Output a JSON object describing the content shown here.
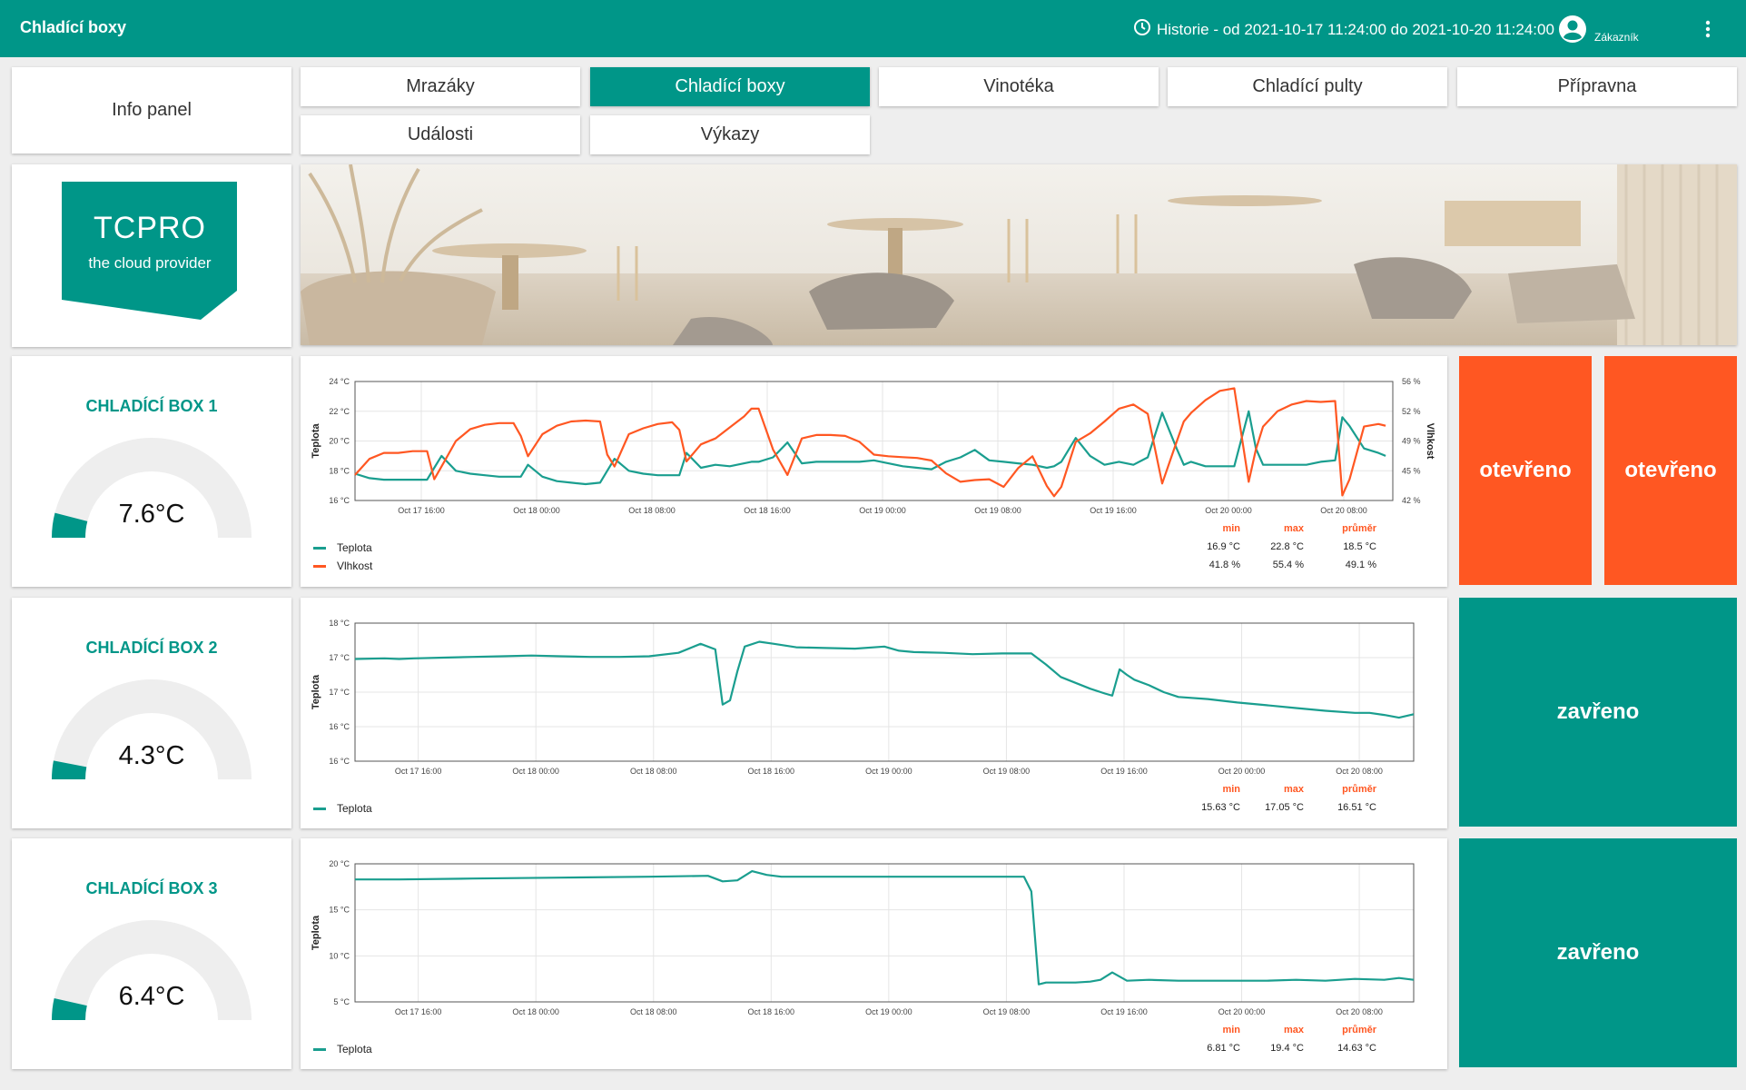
{
  "header": {
    "title": "Chladící boxy",
    "history": "Historie - od 2021-10-17 11:24:00 do 2021-10-20 11:24:00",
    "user_role": "Zákazník",
    "history_icon": "clock-icon",
    "user_icon": "account-circle-icon",
    "menu_icon": "more-vert-icon"
  },
  "colors": {
    "primary": "#009688",
    "accent": "#ff5722",
    "teplota": "#1a9e8f",
    "vlhkost": "#ff5722"
  },
  "nav": {
    "info_panel": "Info panel",
    "tabs": [
      "Mrazáky",
      "Chladící boxy",
      "Vinotéka",
      "Chladící pulty",
      "Přípravna",
      "Události",
      "Výkazy"
    ],
    "active": "Chladící boxy"
  },
  "logo": {
    "name": "TCPRO",
    "tagline": "the cloud provider"
  },
  "boxes": [
    {
      "title": "CHLADÍCÍ BOX 1",
      "value": "7.6°C",
      "fraction": 0.08,
      "status": [
        "otevřeno",
        "otevřeno"
      ]
    },
    {
      "title": "CHLADÍCÍ BOX 2",
      "value": "4.3°C",
      "fraction": 0.06,
      "status": [
        "zavřeno"
      ]
    },
    {
      "title": "CHLADÍCÍ BOX 3",
      "value": "6.4°C",
      "fraction": 0.07,
      "status": [
        "zavřeno"
      ]
    }
  ],
  "stats_labels": {
    "min": "min",
    "max": "max",
    "avg": "průměr"
  },
  "chart_data": [
    {
      "type": "line",
      "ylabel": "Teplota",
      "y2label": "Vlhkost",
      "ylim": [
        16,
        24
      ],
      "yticks": [
        "16 °C",
        "18 °C",
        "20 °C",
        "22 °C",
        "24 °C"
      ],
      "y2lim": [
        42,
        56
      ],
      "y2ticks": [
        "42 %",
        "45 %",
        "49 %",
        "52 %",
        "56 %"
      ],
      "xlim": [
        0,
        72
      ],
      "xticks": [
        4.6,
        12.6,
        20.6,
        28.6,
        36.6,
        44.6,
        52.6,
        60.6,
        68.6
      ],
      "xticklabels": [
        "Oct 17 16:00",
        "Oct 18 00:00",
        "Oct 18 08:00",
        "Oct 18 16:00",
        "Oct 19 00:00",
        "Oct 19 08:00",
        "Oct 19 16:00",
        "Oct 20 00:00",
        "Oct 20 08:00"
      ],
      "x": [
        0,
        1,
        2,
        3,
        4,
        5,
        5.5,
        6,
        7,
        8,
        9,
        10,
        11,
        11.5,
        12,
        13,
        14,
        15,
        16,
        17,
        17.5,
        18,
        19,
        20,
        21,
        22,
        22.5,
        23,
        24,
        25,
        26,
        27,
        27.5,
        28,
        29,
        30,
        31,
        32,
        33,
        34,
        35,
        36,
        37,
        38,
        39,
        40,
        41,
        42,
        43,
        44,
        45,
        46,
        47,
        48,
        48.5,
        49,
        50,
        51,
        52,
        53,
        54,
        55,
        56,
        57,
        57.5,
        58,
        59,
        60,
        61,
        62,
        62.5,
        63,
        64,
        65,
        66,
        67,
        68,
        68.5,
        69,
        70,
        71,
        71.5
      ],
      "series": [
        {
          "name": "Teplota",
          "unit": "°C",
          "values": [
            17.8,
            17.5,
            17.4,
            17.4,
            17.4,
            17.4,
            18.2,
            19.0,
            18.0,
            17.8,
            17.7,
            17.6,
            17.6,
            17.6,
            18.4,
            17.6,
            17.3,
            17.2,
            17.1,
            17.2,
            18.0,
            18.8,
            18.0,
            17.8,
            17.7,
            17.7,
            17.7,
            19.2,
            18.2,
            18.4,
            18.3,
            18.5,
            18.6,
            18.6,
            18.9,
            19.9,
            18.5,
            18.6,
            18.6,
            18.6,
            18.6,
            18.7,
            18.5,
            18.3,
            18.2,
            18.1,
            18.6,
            18.9,
            19.4,
            18.7,
            18.6,
            18.5,
            18.4,
            18.2,
            18.3,
            18.6,
            20.2,
            19.0,
            18.4,
            18.6,
            18.4,
            18.9,
            21.9,
            19.5,
            18.4,
            18.6,
            18.3,
            18.3,
            18.3,
            22.0,
            19.5,
            18.4,
            18.4,
            18.4,
            18.4,
            18.6,
            18.7,
            21.6,
            21.0,
            19.5,
            19.2,
            19.0
          ]
        },
        {
          "name": "Vlhkost",
          "unit": "%",
          "values": [
            45.0,
            46.9,
            47.6,
            47.6,
            47.8,
            47.8,
            44.5,
            46.0,
            49.0,
            50.4,
            50.9,
            51.1,
            51.1,
            49.6,
            47.2,
            49.8,
            50.8,
            51.3,
            51.4,
            51.3,
            47.4,
            46.0,
            49.8,
            50.5,
            51.0,
            51.2,
            50.3,
            46.6,
            48.6,
            49.3,
            50.6,
            51.9,
            52.8,
            52.8,
            48.0,
            45.0,
            49.3,
            49.7,
            49.7,
            49.6,
            48.9,
            47.4,
            47.2,
            47.1,
            47.0,
            46.7,
            45.2,
            44.2,
            44.4,
            44.5,
            43.6,
            45.8,
            47.2,
            43.7,
            42.5,
            43.6,
            48.9,
            49.9,
            51.3,
            52.8,
            53.3,
            52.2,
            44.0,
            48.9,
            51.3,
            52.3,
            53.8,
            54.9,
            55.2,
            44.2,
            48.0,
            50.7,
            52.5,
            53.3,
            53.7,
            53.6,
            53.7,
            42.6,
            44.5,
            50.7,
            51.0,
            50.8
          ]
        }
      ],
      "legend": [
        "Teplota",
        "Vlhkost"
      ],
      "stats": [
        {
          "min": "16.9 °C",
          "max": "22.8 °C",
          "avg": "18.5 °C"
        },
        {
          "min": "41.8 %",
          "max": "55.4 %",
          "avg": "49.1 %"
        }
      ]
    },
    {
      "type": "line",
      "ylabel": "Teplota",
      "ylim": [
        15.6,
        17.6
      ],
      "yticks": [
        "16 °C",
        "16 °C",
        "17 °C",
        "17 °C",
        "18 °C"
      ],
      "xlim": [
        0,
        72
      ],
      "xticks": [
        4.3,
        12.3,
        20.3,
        28.3,
        36.3,
        44.3,
        52.3,
        60.3,
        68.3
      ],
      "xticklabels": [
        "Oct 17 16:00",
        "Oct 18 00:00",
        "Oct 18 08:00",
        "Oct 18 16:00",
        "Oct 19 00:00",
        "Oct 19 08:00",
        "Oct 19 16:00",
        "Oct 20 00:00",
        "Oct 20 08:00"
      ],
      "x": [
        0,
        2,
        3,
        4,
        6,
        8,
        10,
        12,
        14,
        16,
        18,
        20,
        22,
        23.5,
        24.5,
        25,
        25.5,
        26,
        26.5,
        27.5,
        28.5,
        30,
        32,
        34,
        36,
        37,
        38,
        40,
        42,
        44,
        46,
        47,
        48,
        50,
        51,
        51.5,
        52,
        52.5,
        53,
        54,
        55,
        56,
        58,
        60,
        62,
        64,
        66,
        68,
        69,
        70,
        71,
        72
      ],
      "series": [
        {
          "name": "Teplota",
          "unit": "°C",
          "values": [
            17.08,
            17.09,
            17.08,
            17.09,
            17.1,
            17.11,
            17.12,
            17.13,
            17.12,
            17.11,
            17.11,
            17.12,
            17.17,
            17.3,
            17.22,
            16.42,
            16.48,
            16.9,
            17.26,
            17.33,
            17.3,
            17.25,
            17.24,
            17.23,
            17.26,
            17.2,
            17.18,
            17.17,
            17.15,
            17.16,
            17.16,
            17.0,
            16.82,
            16.65,
            16.58,
            16.55,
            16.93,
            16.85,
            16.78,
            16.7,
            16.6,
            16.53,
            16.5,
            16.45,
            16.41,
            16.37,
            16.33,
            16.3,
            16.3,
            16.27,
            16.23,
            16.28
          ]
        }
      ],
      "legend": [
        "Teplota"
      ],
      "stats": [
        {
          "min": "15.63 °C",
          "max": "17.05 °C",
          "avg": "16.51 °C"
        }
      ]
    },
    {
      "type": "line",
      "ylabel": "Teplota",
      "ylim": [
        5,
        20
      ],
      "yticks": [
        "5 °C",
        "10 °C",
        "15 °C",
        "20 °C"
      ],
      "xlim": [
        0,
        72
      ],
      "xticks": [
        4.3,
        12.3,
        20.3,
        28.3,
        36.3,
        44.3,
        52.3,
        60.3,
        68.3
      ],
      "xticklabels": [
        "Oct 17 16:00",
        "Oct 18 00:00",
        "Oct 18 08:00",
        "Oct 18 16:00",
        "Oct 19 00:00",
        "Oct 19 08:00",
        "Oct 19 16:00",
        "Oct 20 00:00",
        "Oct 20 08:00"
      ],
      "x": [
        0,
        3,
        8,
        14,
        20,
        24,
        25,
        26,
        27,
        28,
        29,
        32,
        38,
        44,
        45.5,
        46,
        46.5,
        47,
        48,
        49,
        50,
        50.7,
        51.5,
        52.5,
        54,
        56,
        58,
        60,
        62,
        64,
        66,
        68,
        70,
        71,
        72
      ],
      "series": [
        {
          "name": "Teplota",
          "unit": "°C",
          "values": [
            18.3,
            18.3,
            18.4,
            18.5,
            18.6,
            18.7,
            18.1,
            18.2,
            19.2,
            18.8,
            18.6,
            18.6,
            18.6,
            18.6,
            18.6,
            17.0,
            6.9,
            7.1,
            7.1,
            7.1,
            7.2,
            7.4,
            8.2,
            7.3,
            7.4,
            7.3,
            7.3,
            7.3,
            7.3,
            7.4,
            7.3,
            7.5,
            7.4,
            7.6,
            7.4
          ]
        }
      ],
      "legend": [
        "Teplota"
      ],
      "stats": [
        {
          "min": "6.81 °C",
          "max": "19.4 °C",
          "avg": "14.63 °C"
        }
      ]
    }
  ]
}
